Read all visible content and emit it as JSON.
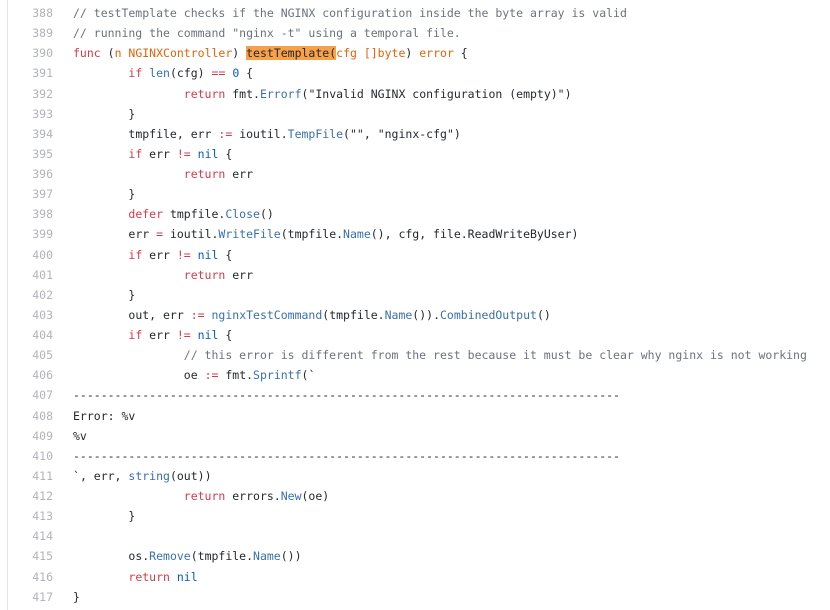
{
  "lines": [
    {
      "n": "388",
      "tokens": [
        {
          "t": "// testTemplate checks if the NGINX configuration inside the byte array is valid",
          "c": "c"
        }
      ]
    },
    {
      "n": "389",
      "tokens": [
        {
          "t": "// running the command \"nginx -t\" using a temporal file.",
          "c": "c"
        }
      ]
    },
    {
      "n": "390",
      "tokens": [
        {
          "t": "func",
          "c": "k"
        },
        {
          "t": " (",
          "c": ""
        },
        {
          "t": "n NGINXController",
          "c": "t"
        },
        {
          "t": ") ",
          "c": ""
        },
        {
          "t": "testTemplate(",
          "c": "h"
        },
        {
          "t": "cfg []byte",
          "c": "t"
        },
        {
          "t": ") ",
          "c": ""
        },
        {
          "t": "error",
          "c": "t"
        },
        {
          "t": " {",
          "c": ""
        }
      ]
    },
    {
      "n": "391",
      "tokens": [
        {
          "t": "\t",
          "c": ""
        },
        {
          "t": "if",
          "c": "k"
        },
        {
          "t": " ",
          "c": ""
        },
        {
          "t": "len",
          "c": "f"
        },
        {
          "t": "(cfg) ",
          "c": ""
        },
        {
          "t": "==",
          "c": "k"
        },
        {
          "t": " ",
          "c": ""
        },
        {
          "t": "0",
          "c": "n"
        },
        {
          "t": " {",
          "c": ""
        }
      ]
    },
    {
      "n": "392",
      "tokens": [
        {
          "t": "\t\t",
          "c": ""
        },
        {
          "t": "return",
          "c": "k"
        },
        {
          "t": " fmt.",
          "c": ""
        },
        {
          "t": "Errorf",
          "c": "f"
        },
        {
          "t": "(",
          "c": ""
        },
        {
          "t": "\"Invalid NGINX configuration (empty)\"",
          "c": "s"
        },
        {
          "t": ")",
          "c": ""
        }
      ]
    },
    {
      "n": "393",
      "tokens": [
        {
          "t": "\t}",
          "c": ""
        }
      ]
    },
    {
      "n": "394",
      "tokens": [
        {
          "t": "\ttmpfile, err ",
          "c": ""
        },
        {
          "t": ":=",
          "c": "k"
        },
        {
          "t": " ioutil.",
          "c": ""
        },
        {
          "t": "TempFile",
          "c": "f"
        },
        {
          "t": "(",
          "c": ""
        },
        {
          "t": "\"\"",
          "c": "s"
        },
        {
          "t": ", ",
          "c": ""
        },
        {
          "t": "\"nginx-cfg\"",
          "c": "s"
        },
        {
          "t": ")",
          "c": ""
        }
      ]
    },
    {
      "n": "395",
      "tokens": [
        {
          "t": "\t",
          "c": ""
        },
        {
          "t": "if",
          "c": "k"
        },
        {
          "t": " err ",
          "c": ""
        },
        {
          "t": "!=",
          "c": "k"
        },
        {
          "t": " ",
          "c": ""
        },
        {
          "t": "nil",
          "c": "n"
        },
        {
          "t": " {",
          "c": ""
        }
      ]
    },
    {
      "n": "396",
      "tokens": [
        {
          "t": "\t\t",
          "c": ""
        },
        {
          "t": "return",
          "c": "k"
        },
        {
          "t": " err",
          "c": ""
        }
      ]
    },
    {
      "n": "397",
      "tokens": [
        {
          "t": "\t}",
          "c": ""
        }
      ]
    },
    {
      "n": "398",
      "tokens": [
        {
          "t": "\t",
          "c": ""
        },
        {
          "t": "defer",
          "c": "k"
        },
        {
          "t": " tmpfile.",
          "c": ""
        },
        {
          "t": "Close",
          "c": "f"
        },
        {
          "t": "()",
          "c": ""
        }
      ]
    },
    {
      "n": "399",
      "tokens": [
        {
          "t": "\terr ",
          "c": ""
        },
        {
          "t": "=",
          "c": "k"
        },
        {
          "t": " ioutil.",
          "c": ""
        },
        {
          "t": "WriteFile",
          "c": "f"
        },
        {
          "t": "(tmpfile.",
          "c": ""
        },
        {
          "t": "Name",
          "c": "f"
        },
        {
          "t": "(), cfg, file.ReadWriteByUser)",
          "c": ""
        }
      ]
    },
    {
      "n": "400",
      "tokens": [
        {
          "t": "\t",
          "c": ""
        },
        {
          "t": "if",
          "c": "k"
        },
        {
          "t": " err ",
          "c": ""
        },
        {
          "t": "!=",
          "c": "k"
        },
        {
          "t": " ",
          "c": ""
        },
        {
          "t": "nil",
          "c": "n"
        },
        {
          "t": " {",
          "c": ""
        }
      ]
    },
    {
      "n": "401",
      "tokens": [
        {
          "t": "\t\t",
          "c": ""
        },
        {
          "t": "return",
          "c": "k"
        },
        {
          "t": " err",
          "c": ""
        }
      ]
    },
    {
      "n": "402",
      "tokens": [
        {
          "t": "\t}",
          "c": ""
        }
      ]
    },
    {
      "n": "403",
      "tokens": [
        {
          "t": "\tout, err ",
          "c": ""
        },
        {
          "t": ":=",
          "c": "k"
        },
        {
          "t": " ",
          "c": ""
        },
        {
          "t": "nginxTestCommand",
          "c": "f"
        },
        {
          "t": "(tmpfile.",
          "c": ""
        },
        {
          "t": "Name",
          "c": "f"
        },
        {
          "t": "()).",
          "c": ""
        },
        {
          "t": "CombinedOutput",
          "c": "f"
        },
        {
          "t": "()",
          "c": ""
        }
      ]
    },
    {
      "n": "404",
      "tokens": [
        {
          "t": "\t",
          "c": ""
        },
        {
          "t": "if",
          "c": "k"
        },
        {
          "t": " err ",
          "c": ""
        },
        {
          "t": "!=",
          "c": "k"
        },
        {
          "t": " ",
          "c": ""
        },
        {
          "t": "nil",
          "c": "n"
        },
        {
          "t": " {",
          "c": ""
        }
      ]
    },
    {
      "n": "405",
      "tokens": [
        {
          "t": "\t\t",
          "c": ""
        },
        {
          "t": "// this error is different from the rest because it must be clear why nginx is not working",
          "c": "c"
        }
      ]
    },
    {
      "n": "406",
      "tokens": [
        {
          "t": "\t\toe ",
          "c": ""
        },
        {
          "t": ":=",
          "c": "k"
        },
        {
          "t": " fmt.",
          "c": ""
        },
        {
          "t": "Sprintf",
          "c": "f"
        },
        {
          "t": "(`",
          "c": "s"
        }
      ]
    },
    {
      "n": "407",
      "tokens": [
        {
          "t": "-------------------------------------------------------------------------------",
          "c": "s"
        }
      ]
    },
    {
      "n": "408",
      "tokens": [
        {
          "t": "Error: %v",
          "c": "s"
        }
      ]
    },
    {
      "n": "409",
      "tokens": [
        {
          "t": "%v",
          "c": "s"
        }
      ]
    },
    {
      "n": "410",
      "tokens": [
        {
          "t": "-------------------------------------------------------------------------------",
          "c": "s"
        }
      ]
    },
    {
      "n": "411",
      "tokens": [
        {
          "t": "`",
          "c": "s"
        },
        {
          "t": ", err, ",
          "c": ""
        },
        {
          "t": "string",
          "c": "f"
        },
        {
          "t": "(out))",
          "c": ""
        }
      ]
    },
    {
      "n": "412",
      "tokens": [
        {
          "t": "\t\t",
          "c": ""
        },
        {
          "t": "return",
          "c": "k"
        },
        {
          "t": " errors.",
          "c": ""
        },
        {
          "t": "New",
          "c": "f"
        },
        {
          "t": "(oe)",
          "c": ""
        }
      ]
    },
    {
      "n": "413",
      "tokens": [
        {
          "t": "\t}",
          "c": ""
        }
      ]
    },
    {
      "n": "414",
      "tokens": []
    },
    {
      "n": "415",
      "tokens": [
        {
          "t": "\tos.",
          "c": ""
        },
        {
          "t": "Remove",
          "c": "f"
        },
        {
          "t": "(tmpfile.",
          "c": ""
        },
        {
          "t": "Name",
          "c": "f"
        },
        {
          "t": "())",
          "c": ""
        }
      ]
    },
    {
      "n": "416",
      "tokens": [
        {
          "t": "\t",
          "c": ""
        },
        {
          "t": "return",
          "c": "k"
        },
        {
          "t": " ",
          "c": ""
        },
        {
          "t": "nil",
          "c": "n"
        }
      ]
    },
    {
      "n": "417",
      "tokens": [
        {
          "t": "}",
          "c": ""
        }
      ]
    }
  ]
}
